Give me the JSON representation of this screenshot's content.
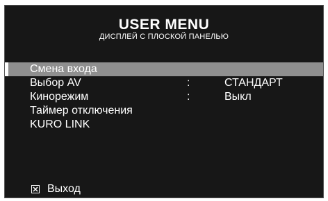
{
  "header": {
    "title": "USER MENU",
    "subtitle": "ДИСПЛЕЙ С ПЛОСКОЙ ПАНЕЛЬЮ"
  },
  "menu": {
    "items": [
      {
        "label": "Смена входа",
        "selected": true
      },
      {
        "label": "Выбор AV",
        "separator": ":",
        "value": "СТАНДАРТ"
      },
      {
        "label": "Кинорежим",
        "separator": ":",
        "value": "Выкл"
      },
      {
        "label": "Таймер отключения"
      },
      {
        "label": "KURO LINK"
      }
    ]
  },
  "footer": {
    "exit_icon": "close-box-icon",
    "exit_label": "Выход"
  },
  "colors": {
    "background": "#171717",
    "highlight": "#8f8f8f",
    "text": "#ffffff"
  }
}
